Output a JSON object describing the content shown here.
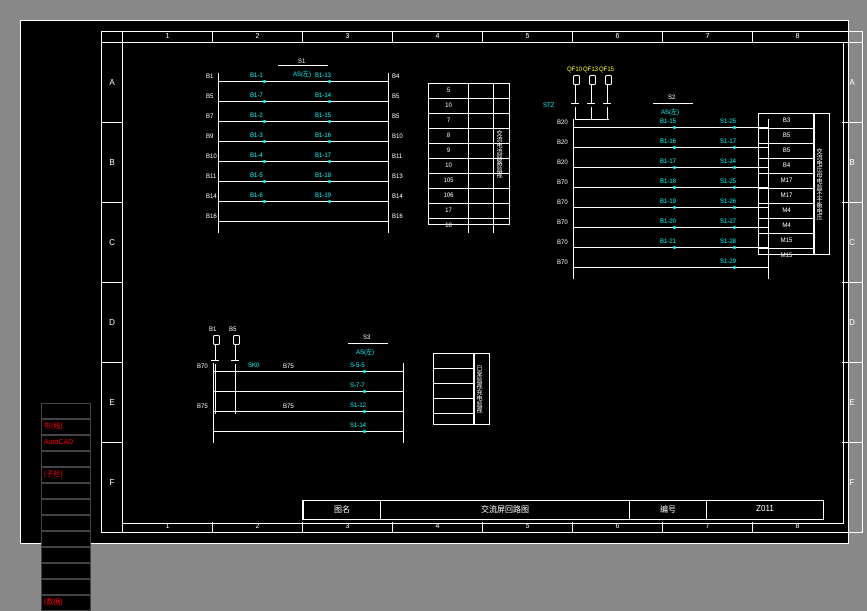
{
  "app": "AutoCAD",
  "cols": [
    "1",
    "2",
    "3",
    "4",
    "5",
    "6",
    "7",
    "8"
  ],
  "rows": [
    "A",
    "B",
    "C",
    "D",
    "E",
    "F"
  ],
  "title": {
    "c1": "图名",
    "c2": "交流屏回路图",
    "c3": "编号",
    "c4": "Z011"
  },
  "layers": [
    "",
    "布(线)",
    "AutoCAD",
    "",
    "(子栏)",
    "",
    "",
    "",
    "",
    "",
    "",
    "",
    "(数据)"
  ],
  "b1": {
    "hdr": "S1",
    "sub": "AS(左)",
    "rows": [
      [
        "B1",
        "B1-1",
        "B1-13",
        "B4"
      ],
      [
        "B5",
        "B1-7",
        "B1-14",
        "B5"
      ],
      [
        "B7",
        "B1-2",
        "B1-15",
        "B5"
      ],
      [
        "B9",
        "B1-3",
        "B1-16",
        "B10"
      ],
      [
        "B10",
        "B1-4",
        "B1-17",
        "B11"
      ],
      [
        "B11",
        "B1-5",
        "B1-18",
        "B13"
      ],
      [
        "B14",
        "B1-6",
        "B1-19",
        "B14"
      ],
      [
        "B16",
        "",
        "",
        "B16"
      ]
    ]
  },
  "t1": {
    "rows": [
      "5",
      "10",
      "7",
      "8",
      "9",
      "10",
      "105",
      "106",
      "17",
      "18"
    ],
    "side": [
      "交",
      "流",
      "电",
      "流",
      "",
      "回",
      "路",
      "监",
      "视"
    ]
  },
  "b2": {
    "hdr": "S2",
    "sub": "AS(左)",
    "q": [
      "QF10",
      "QF13",
      "QF15"
    ],
    "lab": "STZ",
    "rows": [
      [
        "B20",
        "B1-15",
        "S1-25"
      ],
      [
        "B20",
        "B1-16",
        "S1-17"
      ],
      [
        "B20",
        "B1-17",
        "S1-24"
      ],
      [
        "B70",
        "B1-18",
        "S1-25"
      ],
      [
        "B70",
        "B1-19",
        "S1-26"
      ],
      [
        "B70",
        "B1-20",
        "S1-27"
      ],
      [
        "B70",
        "B1-21",
        "S1-28"
      ],
      [
        "B70",
        "",
        "S1-29"
      ]
    ]
  },
  "t2": {
    "rows": [
      "B3",
      "B5",
      "B5",
      "B4",
      "M17",
      "M17",
      "M4",
      "M4",
      "M15",
      "M15"
    ],
    "side": [
      "交",
      "流",
      "电",
      "压",
      "",
      "母",
      "电",
      "监",
      "",
      "不",
      "平",
      "衡",
      "电",
      "压"
    ]
  },
  "b3": {
    "hdr": "S3",
    "sub": "AS(左)",
    "q": [
      "B1",
      "B5"
    ],
    "rows": [
      [
        "B70",
        "SK0",
        "B75",
        "",
        "S-5-5"
      ],
      [
        "",
        "",
        "",
        "",
        "S-7-7"
      ],
      [
        "B75",
        "",
        "B75",
        "",
        "S1-12"
      ],
      [
        "",
        "",
        "",
        "",
        "S1-14"
      ]
    ]
  },
  "t3": {
    "rows": [
      "",
      "",
      "",
      "",
      ""
    ],
    "side": [
      "日",
      "常",
      "监",
      "视",
      "",
      "充",
      "电",
      "监",
      "视"
    ]
  }
}
